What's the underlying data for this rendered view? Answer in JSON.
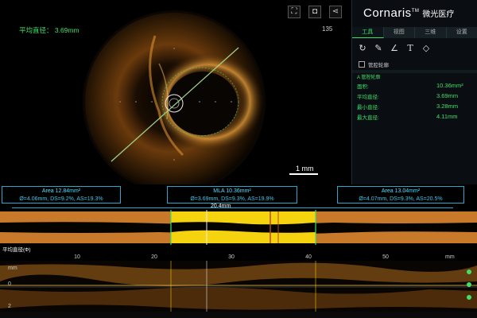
{
  "overlay": {
    "avg_diameter": "平均直径： 3.69mm",
    "frame_number": "135",
    "scale_bar": "1 mm"
  },
  "toolbar_icons": [
    "expand-icon",
    "camera-icon",
    "share-icon"
  ],
  "right_panel": {
    "logo": "Cornaris",
    "logo_tm": "TM",
    "logo_cn": "微光医疗",
    "tabs": [
      "工具",
      "视图",
      "三维",
      "设置"
    ],
    "active_tab": "工具",
    "tools": [
      "rotate-icon",
      "pen-icon",
      "angle-icon",
      "text-icon",
      "eraser-icon"
    ],
    "contour_checkbox_label": "管腔轮廓",
    "measure_title": "A 管腔轮廓",
    "measurements": [
      {
        "label": "面积:",
        "value": "10.36mm²"
      },
      {
        "label": "平均直径:",
        "value": "3.69mm"
      },
      {
        "label": "最小直径:",
        "value": "3.28mm"
      },
      {
        "label": "最大直径:",
        "value": "4.11mm"
      }
    ]
  },
  "info_boxes": [
    {
      "title": "Area 12.84mm²",
      "detail": "Ø=4.06mm, DS=9.2%, AS=19.3%"
    },
    {
      "title": "MLA 10.36mm²",
      "detail": "Ø=3.69mm, DS=9.3%, AS=19.9%"
    },
    {
      "title": "Area 13.04mm²",
      "detail": "Ø=4.07mm, DS=9.3%, AS=20.5%"
    }
  ],
  "segment_length": "20.4mm",
  "lumen_profile_label": "平均直径(Φ)",
  "axis": {
    "ticks": [
      "10",
      "20",
      "30",
      "40",
      "50"
    ],
    "unit": "mm",
    "depth_unit": "mm",
    "depth_labels": [
      "0",
      "2"
    ]
  },
  "colors": {
    "accent_green": "#3fe06a",
    "info_cyan": "#2aa7c9",
    "selection_yellow": "#f5d40f",
    "tissue_orange": "#c87a2a"
  }
}
